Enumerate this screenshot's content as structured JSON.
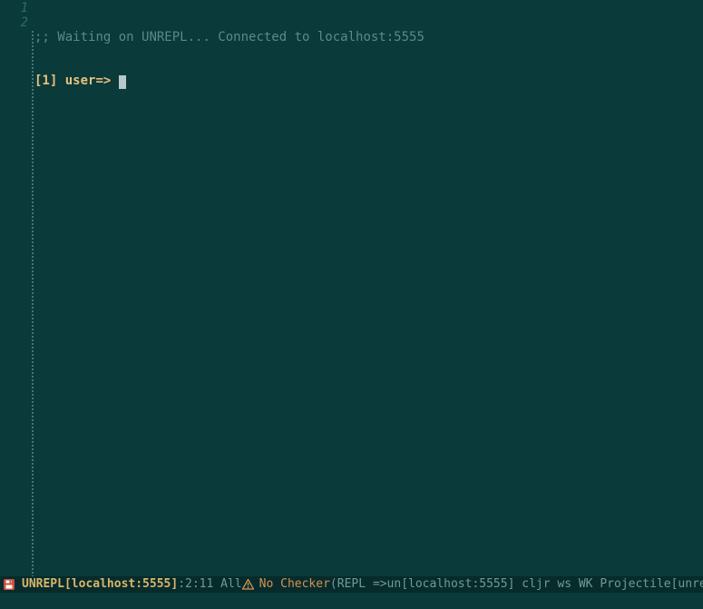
{
  "gutter": {
    "line1": "1",
    "line2": "2"
  },
  "line1": {
    "comment_prefix": ";; ",
    "comment_text": "Waiting on UNREPL... Connected to localhost:5555"
  },
  "line2": {
    "prompt_bracket": "[1]",
    "prompt_ns": " user=> "
  },
  "modeline": {
    "buffer_name": "UNREPL[localhost:5555]",
    "position": ":2:11 All",
    "no_checker": "No Checker",
    "modes": "(REPL =>un[localhost:5555] cljr ws WK Projectile[unre"
  },
  "icons": {
    "save": "save-icon",
    "warn": "warning-icon"
  }
}
